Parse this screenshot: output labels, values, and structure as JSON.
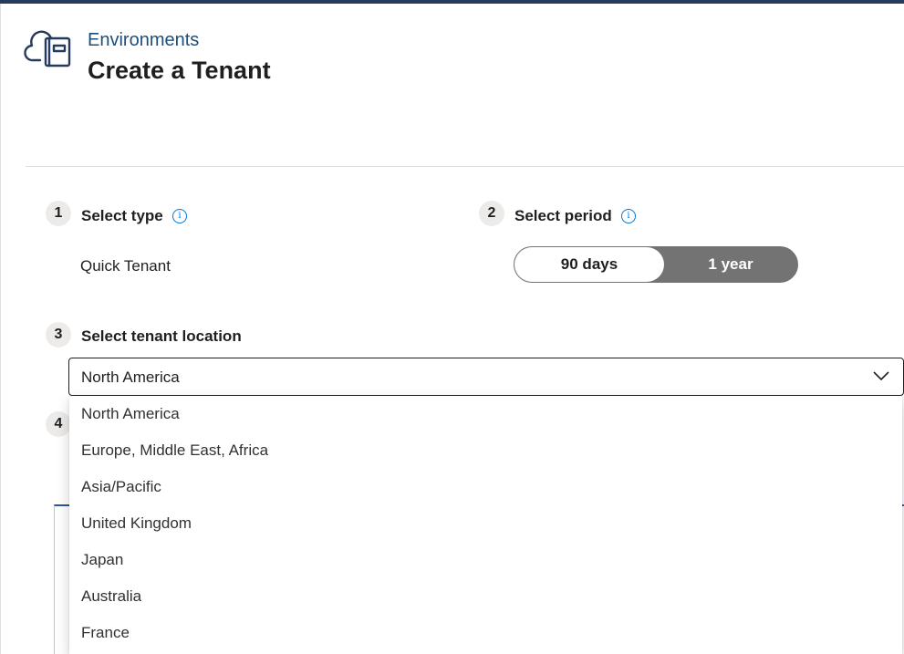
{
  "header": {
    "breadcrumb": "Environments",
    "title": "Create a Tenant",
    "icon": "cloud-book-icon"
  },
  "steps": {
    "type": {
      "number": "1",
      "label": "Select type",
      "value": "Quick Tenant"
    },
    "period": {
      "number": "2",
      "label": "Select period",
      "options": [
        "90 days",
        "1 year"
      ],
      "selected": "90 days"
    },
    "location": {
      "number": "3",
      "label": "Select tenant location",
      "selected": "North America",
      "options": [
        "North America",
        "Europe, Middle East, Africa",
        "Asia/Pacific",
        "United Kingdom",
        "Japan",
        "Australia",
        "France"
      ]
    },
    "step4": {
      "number": "4"
    }
  },
  "colors": {
    "topbar": "#243a5e",
    "accent": "#0078d4",
    "toggle_inactive": "#737373"
  }
}
